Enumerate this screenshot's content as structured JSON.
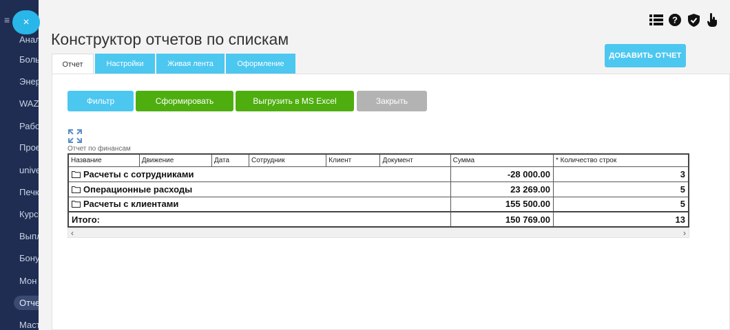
{
  "sidebar": {
    "items": [
      {
        "label": "Анал"
      },
      {
        "label": "Боль"
      },
      {
        "label": "Энер"
      },
      {
        "label": "WAZ"
      },
      {
        "label": "Рабо"
      },
      {
        "label": "Прое"
      },
      {
        "label": "unive"
      },
      {
        "label": "Печк"
      },
      {
        "label": "Курс"
      },
      {
        "label": "Выпл"
      },
      {
        "label": "Бону"
      },
      {
        "label": "Мон"
      },
      {
        "label": "Отче"
      },
      {
        "label": "Маст"
      }
    ]
  },
  "modal": {
    "close_label": "×",
    "title": "Конструктор отчетов по спискам",
    "add_report_label": "ДОБАВИТЬ ОТЧЕТ",
    "top_icons": [
      "list-icon",
      "help-icon",
      "shield-icon",
      "hand-icon"
    ],
    "tabs": [
      {
        "label": "Отчет",
        "active": true
      },
      {
        "label": "Настройки",
        "active": false
      },
      {
        "label": "Живая лента",
        "active": false
      },
      {
        "label": "Оформление",
        "active": false
      }
    ],
    "actions": {
      "filter": "Фильтр",
      "form": "Сформировать",
      "excel": "Выгрузить в MS Excel",
      "close": "Закрыть"
    },
    "report_caption": "Отчет по финансам",
    "table": {
      "columns": [
        "Название",
        "Движение",
        "Дата",
        "Сотрудник",
        "Клиент",
        "Документ",
        "Сумма",
        "* Количество строк"
      ],
      "rows": [
        {
          "name": "Расчеты с сотрудниками",
          "sum": "-28 000.00",
          "count": "3"
        },
        {
          "name": "Операционные расходы",
          "sum": "23 269.00",
          "count": "5"
        },
        {
          "name": "Расчеты с клиентами",
          "sum": "155 500.00",
          "count": "5"
        }
      ],
      "total": {
        "name": "Итого:",
        "sum": "150 769.00",
        "count": "13"
      }
    },
    "scroll": {
      "left": "‹",
      "right": "›"
    }
  },
  "colors": {
    "accent": "#4cc7f0",
    "green": "#4eae0f",
    "gray_button": "#b3b3b3",
    "sidebar": "#1f2d52"
  }
}
